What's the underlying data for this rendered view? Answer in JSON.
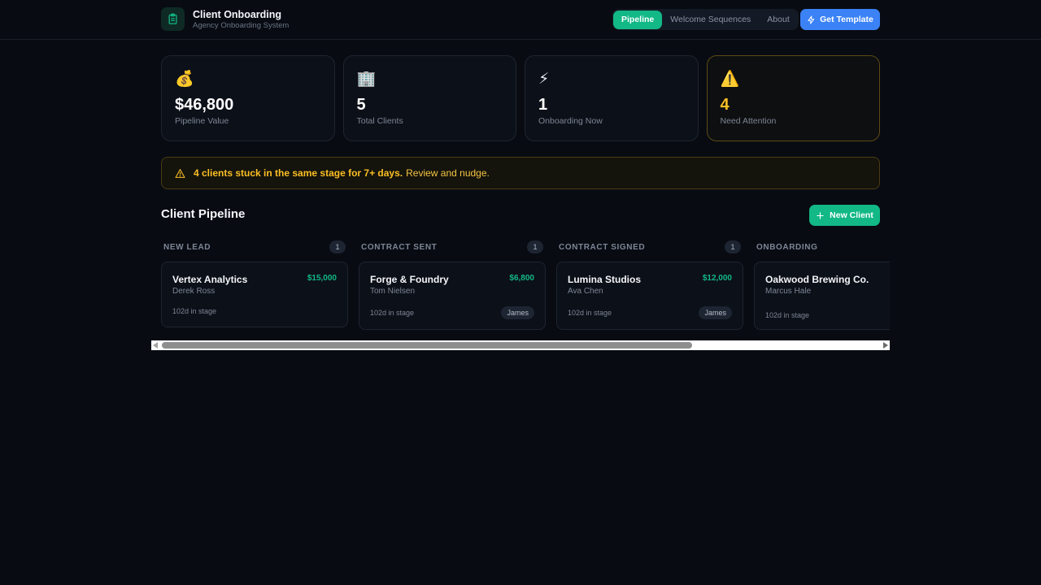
{
  "app": {
    "title": "Client Onboarding",
    "subtitle": "Agency Onboarding System"
  },
  "nav": {
    "tabs": [
      {
        "label": "Pipeline",
        "active": true
      },
      {
        "label": "Welcome Sequences",
        "active": false
      },
      {
        "label": "About",
        "active": false
      }
    ],
    "cta_label": "Get Template"
  },
  "stats": [
    {
      "icon": "money-bag-icon",
      "glyph": "💰",
      "value": "$46,800",
      "label": "Pipeline Value"
    },
    {
      "icon": "office-building-icon",
      "glyph": "🏢",
      "value": "5",
      "label": "Total Clients"
    },
    {
      "icon": "lightning-icon",
      "glyph": "⚡",
      "value": "1",
      "label": "Onboarding Now"
    },
    {
      "icon": "warning-icon",
      "glyph": "⚠️",
      "value": "4",
      "label": "Need Attention"
    }
  ],
  "alert": {
    "strong": "4 clients stuck in the same stage for 7+ days.",
    "rest": "Review and nudge."
  },
  "pipeline": {
    "title": "Client Pipeline",
    "new_client_label": "New Client",
    "columns": [
      {
        "name": "NEW LEAD",
        "count": "1",
        "card": {
          "name": "Vertex Analytics",
          "amount": "$15,000",
          "contact": "Derek Ross",
          "days": "102d in stage",
          "tag": ""
        }
      },
      {
        "name": "CONTRACT SENT",
        "count": "1",
        "card": {
          "name": "Forge & Foundry",
          "amount": "$6,800",
          "contact": "Tom Nielsen",
          "days": "102d in stage",
          "tag": "James"
        }
      },
      {
        "name": "CONTRACT SIGNED",
        "count": "1",
        "card": {
          "name": "Lumina Studios",
          "amount": "$12,000",
          "contact": "Ava Chen",
          "days": "102d in stage",
          "tag": "James"
        }
      },
      {
        "name": "ONBOARDING",
        "count": "",
        "card": {
          "name": "Oakwood Brewing Co.",
          "amount": "",
          "contact": "Marcus Hale",
          "days": "102d in stage",
          "tag": ""
        }
      }
    ]
  },
  "colors": {
    "accent_green": "#12b886",
    "accent_blue": "#3b82f6",
    "warning": "#fbbf24",
    "background": "#080b12"
  }
}
